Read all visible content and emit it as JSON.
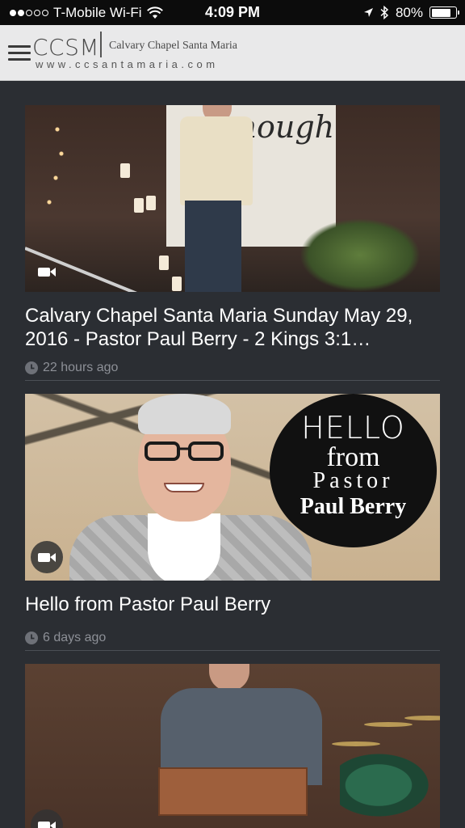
{
  "status_bar": {
    "carrier": "T-Mobile Wi-Fi",
    "time": "4:09 PM",
    "battery": "80%",
    "battery_level": 0.8,
    "signal_bars_filled": 2,
    "signal_bars_total": 5
  },
  "header": {
    "logo_text": "CCSM",
    "church_name": "Calvary Chapel Santa Maria",
    "url": "www.ccsantamaria.com"
  },
  "posts": [
    {
      "title": "Calvary Chapel Santa Maria Sunday May 29, 2016 - Pastor Paul Berry - 2 Kings 3:1…",
      "time_ago": "22 hours ago",
      "thumb_text": "enough"
    },
    {
      "title": "Hello from Pastor Paul Berry",
      "time_ago": "6 days ago",
      "thumb_text": {
        "hello": "HELLO",
        "from": "from",
        "pastor": "Pastor",
        "name": "Paul Berry"
      }
    },
    {
      "title": "",
      "time_ago": ""
    }
  ],
  "icons": {
    "menu": "hamburger-menu-icon",
    "video": "video-camera-icon",
    "clock": "clock-icon",
    "wifi": "wifi-icon",
    "location": "location-arrow-icon",
    "bluetooth": "bluetooth-icon",
    "battery": "battery-icon"
  },
  "colors": {
    "background": "#2b2e33",
    "header_bg": "#e9e9ea",
    "meta_text": "#8d9097"
  }
}
